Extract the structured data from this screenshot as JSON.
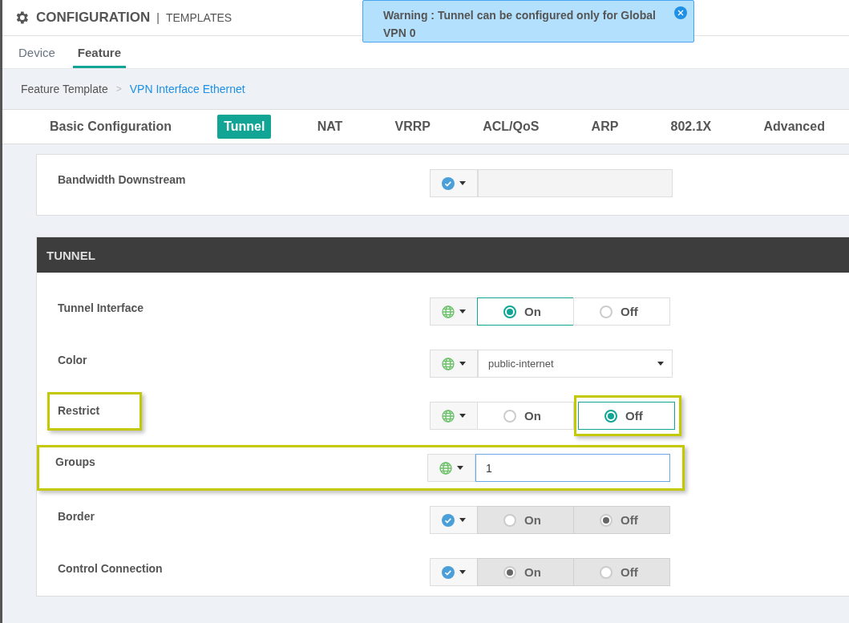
{
  "header": {
    "title": "CONFIGURATION",
    "separator": "|",
    "subtitle": "TEMPLATES"
  },
  "toast": {
    "text": "Warning : Tunnel can be configured only for Global VPN 0"
  },
  "tabs": [
    {
      "label": "Device",
      "selected": false
    },
    {
      "label": "Feature",
      "selected": true
    }
  ],
  "breadcrumb": {
    "separator": ">",
    "items": [
      {
        "label": "Feature Template",
        "kind": "text"
      },
      {
        "label": "VPN Interface Ethernet",
        "kind": "link"
      }
    ]
  },
  "section_tabs": [
    {
      "label": "Basic Configuration",
      "selected": false
    },
    {
      "label": "Tunnel",
      "selected": true
    },
    {
      "label": "NAT",
      "selected": false
    },
    {
      "label": "VRRP",
      "selected": false
    },
    {
      "label": "ACL/QoS",
      "selected": false
    },
    {
      "label": "ARP",
      "selected": false
    },
    {
      "label": "802.1X",
      "selected": false
    },
    {
      "label": "Advanced",
      "selected": false
    }
  ],
  "sections": [
    {
      "rows": [
        {
          "label": "Bandwidth Downstream",
          "global": false,
          "kind": "input",
          "disabled": true
        }
      ]
    },
    {
      "title": "TUNNEL",
      "rows": [
        {
          "label": "Tunnel Interface",
          "global": true,
          "kind": "toggle",
          "disabled": false,
          "options": [
            {
              "label": "On",
              "selected": true
            },
            {
              "label": "Off",
              "selected": false
            }
          ]
        },
        {
          "label": "Color",
          "global": true,
          "kind": "select",
          "value": "public-internet"
        },
        {
          "label": "Restrict",
          "global": true,
          "kind": "toggle",
          "disabled": false,
          "label_highlighted": true,
          "options": [
            {
              "label": "On",
              "selected": false
            },
            {
              "label": "Off",
              "selected": true,
              "highlighted": true
            }
          ]
        },
        {
          "label": "Groups",
          "global": true,
          "kind": "input",
          "disabled": false,
          "value": "1",
          "highlighted": true
        },
        {
          "label": "Border",
          "global": false,
          "kind": "toggle",
          "disabled": true,
          "options": [
            {
              "label": "On",
              "selected": false
            },
            {
              "label": "Off",
              "selected": true
            }
          ]
        },
        {
          "label": "Control Connection",
          "global": false,
          "kind": "toggle",
          "disabled": true,
          "options": [
            {
              "label": "On",
              "selected": true
            },
            {
              "label": "Off",
              "selected": false
            }
          ]
        }
      ]
    }
  ]
}
